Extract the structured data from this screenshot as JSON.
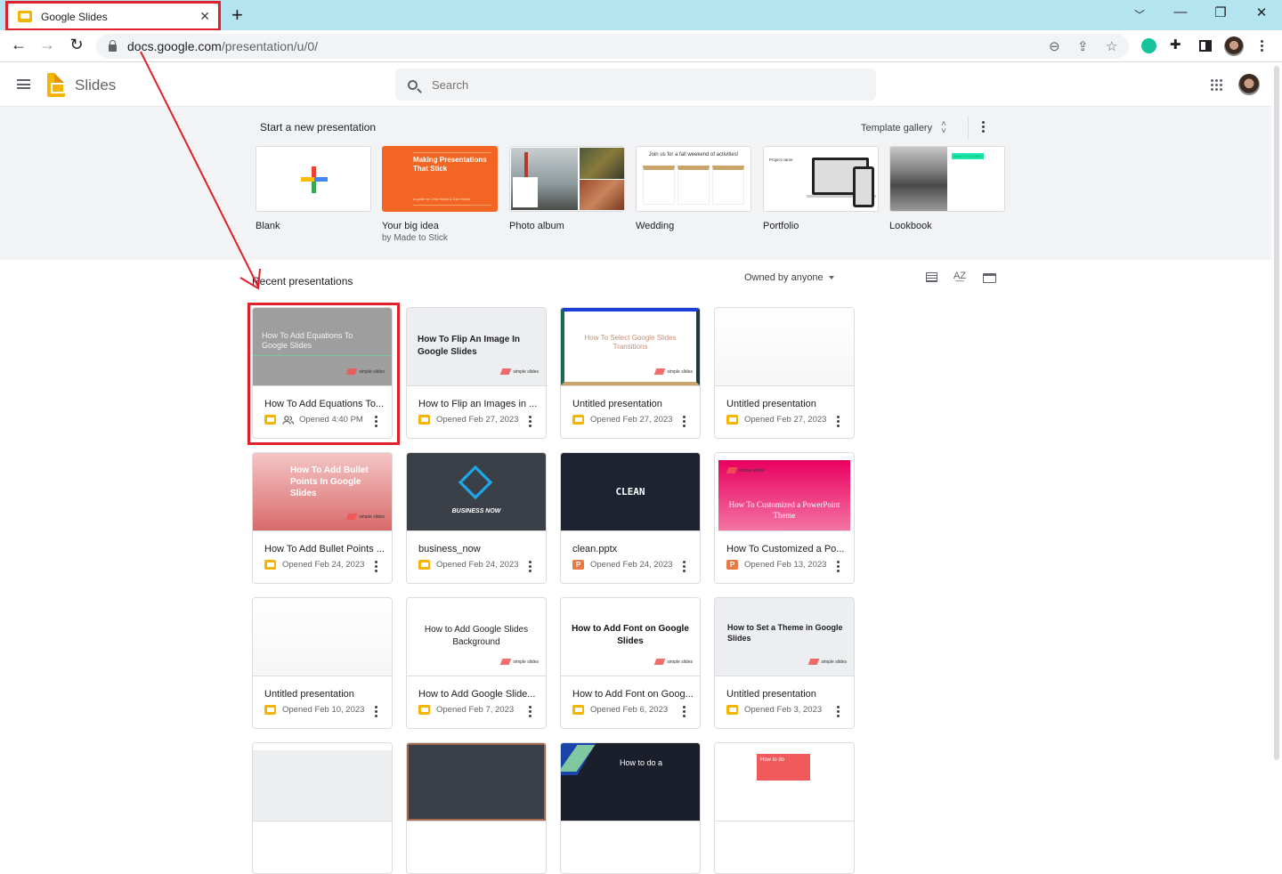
{
  "browser": {
    "tab_title": "Google Slides",
    "url_host": "docs.google.com",
    "url_path": "/presentation/u/0/",
    "accent": "#e0202a"
  },
  "app": {
    "name": "Slides",
    "search_placeholder": "Search"
  },
  "templates": {
    "heading": "Start a new presentation",
    "gallery_label": "Template gallery",
    "items": [
      {
        "name": "Blank",
        "sub": ""
      },
      {
        "name": "Your big idea",
        "sub": "by Made to Stick",
        "thumb_title": "Making Presentations That Stick",
        "thumb_sub": "A guide by Chip Heath & Dan Heath"
      },
      {
        "name": "Photo album",
        "sub": ""
      },
      {
        "name": "Wedding",
        "sub": "",
        "thumb_title": "Join us for a fall weekend of activities!"
      },
      {
        "name": "Portfolio",
        "sub": "",
        "thumb_title": "Project name"
      },
      {
        "name": "Lookbook",
        "sub": "",
        "thumb_title": "WHAT I'M DOING"
      }
    ]
  },
  "recent": {
    "heading": "Recent presentations",
    "owner_filter": "Owned by anyone",
    "files": [
      {
        "title": "How To Add Equations To...",
        "opened": "Opened 4:40 PM",
        "type": "slides",
        "shared": true,
        "thumb": "How To Add Equations To Google Slides"
      },
      {
        "title": "How to Flip an Images in ...",
        "opened": "Opened Feb 27, 2023",
        "type": "slides",
        "thumb": "How To Flip An Image In Google Slides"
      },
      {
        "title": "Untitled presentation",
        "opened": "Opened Feb 27, 2023",
        "type": "slides",
        "thumb": "How To Select Google Slides Transitions"
      },
      {
        "title": "Untitled presentation",
        "opened": "Opened Feb 27, 2023",
        "type": "slides",
        "thumb": ""
      },
      {
        "title": "How To Add Bullet Points ...",
        "opened": "Opened Feb 24, 2023",
        "type": "slides",
        "thumb": "How To Add Bullet Points In Google Slides"
      },
      {
        "title": "business_now",
        "opened": "Opened Feb 24, 2023",
        "type": "slides",
        "thumb": "BUSINESS NOW"
      },
      {
        "title": "clean.pptx",
        "opened": "Opened Feb 24, 2023",
        "type": "pptx",
        "thumb": "CLEAN"
      },
      {
        "title": "How To Customized a Po...",
        "opened": "Opened Feb 13, 2023",
        "type": "pptx",
        "thumb": "How To Customized a PowerPoint Theme"
      },
      {
        "title": "Untitled presentation",
        "opened": "Opened Feb 10, 2023",
        "type": "slides",
        "thumb": ""
      },
      {
        "title": "How to Add Google Slide...",
        "opened": "Opened Feb 7, 2023",
        "type": "slides",
        "thumb": "How to Add Google Slides Background"
      },
      {
        "title": "How to Add Font on Goog...",
        "opened": "Opened Feb 6, 2023",
        "type": "slides",
        "thumb": "How to Add Font on Google Slides"
      },
      {
        "title": "Untitled presentation",
        "opened": "Opened Feb 3, 2023",
        "type": "slides",
        "thumb": "How to Set a Theme in Google Slides"
      }
    ],
    "partial_row_thumbs": [
      "",
      "",
      "How to do a",
      "How to do"
    ],
    "brand_watermark": "simple slides",
    "ppt_letter": "P"
  }
}
